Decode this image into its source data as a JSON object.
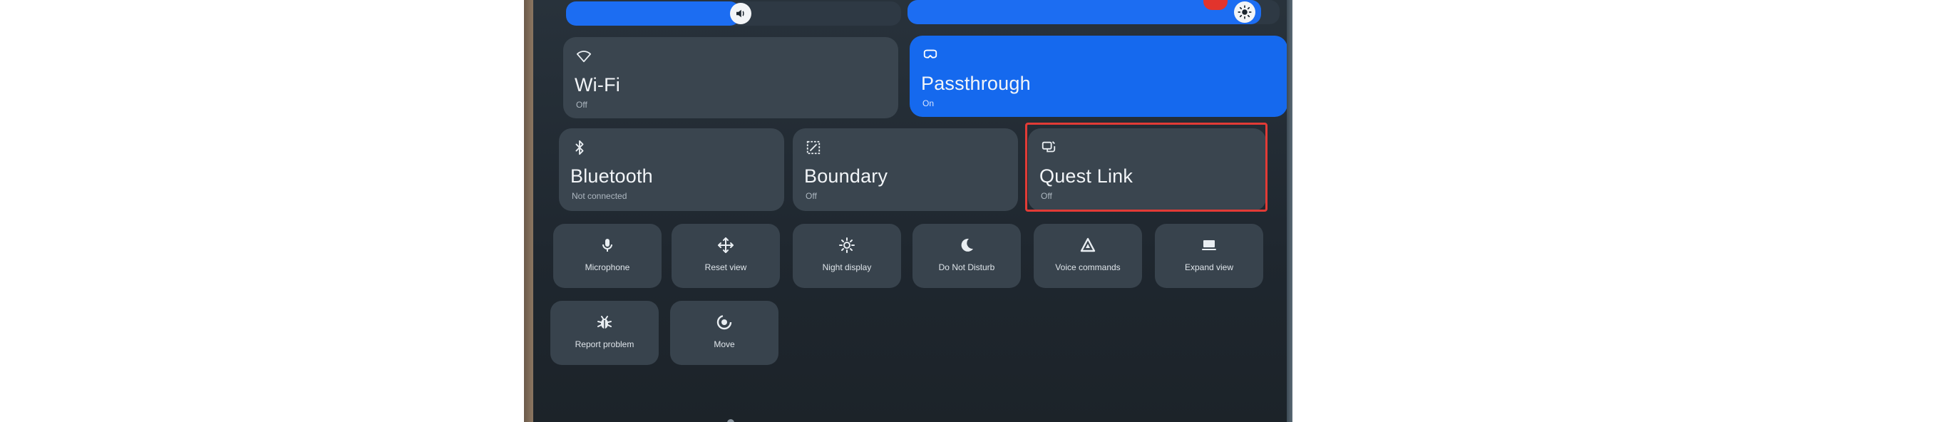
{
  "colors": {
    "accent": "#1569ee",
    "tile_off": "#3a454f",
    "panel": "#232c34",
    "highlight": "#e23b36"
  },
  "sliders": {
    "volume": {
      "icon": "speaker-icon",
      "level": 0.52
    },
    "brightness": {
      "icon": "sun-icon",
      "level": 0.95
    }
  },
  "tiles": {
    "wifi": {
      "icon": "wifi-icon",
      "label": "Wi-Fi",
      "state": "Off"
    },
    "passthrough": {
      "icon": "passthrough-icon",
      "label": "Passthrough",
      "state": "On"
    },
    "bluetooth": {
      "icon": "bluetooth-icon",
      "label": "Bluetooth",
      "state": "Not connected"
    },
    "boundary": {
      "icon": "boundary-icon",
      "label": "Boundary",
      "state": "Off"
    },
    "quest_link": {
      "icon": "quest-link-icon",
      "label": "Quest Link",
      "state": "Off"
    }
  },
  "quick_actions": [
    {
      "icon": "microphone-icon",
      "label": "Microphone"
    },
    {
      "icon": "reset-view-icon",
      "label": "Reset view"
    },
    {
      "icon": "night-display-icon",
      "label": "Night display"
    },
    {
      "icon": "moon-icon",
      "label": "Do Not Disturb"
    },
    {
      "icon": "voice-commands-icon",
      "label": "Voice commands"
    },
    {
      "icon": "expand-view-icon",
      "label": "Expand view"
    },
    {
      "icon": "bug-icon",
      "label": "Report problem"
    },
    {
      "icon": "move-icon",
      "label": "Move"
    }
  ]
}
